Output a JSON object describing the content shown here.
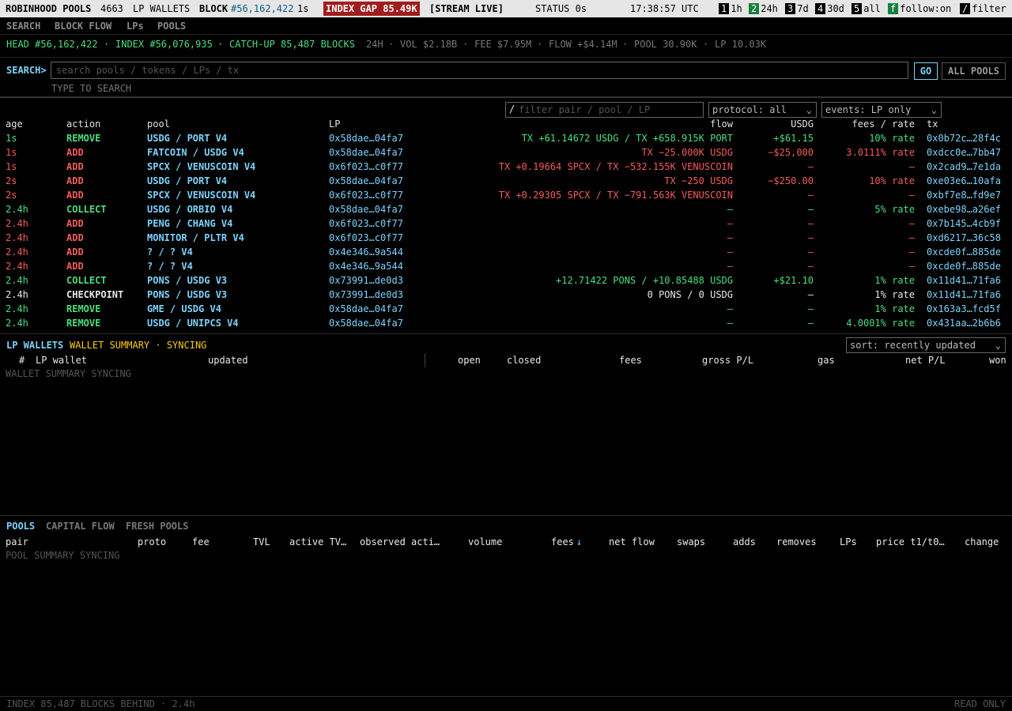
{
  "topbar": {
    "app_name": "ROBINHOOD POOLS",
    "wallet_count": "4663",
    "wallets_label": "LP WALLETS",
    "block_label": "BLOCK",
    "block_number": "#56,162,422",
    "block_age": "1s",
    "index_gap": "INDEX GAP 85.49K",
    "stream": "[STREAM LIVE]",
    "status": "STATUS 0s",
    "clock": "17:38:57 UTC",
    "ranges": [
      {
        "key": "1",
        "label": "1h"
      },
      {
        "key": "2",
        "label": "24h"
      },
      {
        "key": "3",
        "label": "7d"
      },
      {
        "key": "4",
        "label": "30d"
      },
      {
        "key": "5",
        "label": "all"
      }
    ],
    "follow_key": "f",
    "follow_label": "follow:",
    "follow_value": "on",
    "filter_key": "/",
    "filter_label": "filter",
    "active_range_color": "#15803d"
  },
  "nav": {
    "items": [
      "SEARCH",
      "BLOCK FLOW",
      "LPs",
      "POOLS"
    ]
  },
  "headline": {
    "head": "HEAD #56,162,422",
    "index": "INDEX #56,076,935",
    "catchup": "CATCH-UP 85,487 BLOCKS",
    "window": "24H",
    "vol": "VOL $2.18B",
    "fee": "FEE $7.95M",
    "flow": "FLOW +$4.14M",
    "pool": "POOL 30.90K",
    "lp": "LP 10.03K",
    "dot": "·"
  },
  "search": {
    "prompt": "SEARCH>",
    "placeholder": "search pools / tokens / LPs / tx",
    "go": "GO",
    "all_pools": "ALL POOLS",
    "hint": "TYPE TO SEARCH"
  },
  "events": {
    "filter_slash": "/",
    "filter_placeholder": "filter pair / pool / LP",
    "protocol": "protocol: all",
    "event_type": "events: LP only",
    "chevron": "⌄",
    "headers": {
      "age": "age",
      "action": "action",
      "pool": "pool",
      "lp": "LP",
      "flow": "flow",
      "usdg": "USDG",
      "fees": "fees / rate",
      "tx": "tx"
    },
    "rows": [
      {
        "age": "1s",
        "action": "REMOVE",
        "pool": "USDG / PORT V4",
        "lp": "0x58dae…04fa7",
        "flow": "TX +61.14672 USDG / TX +658.915K PORT",
        "usdg": "+$61.15",
        "fees": "10% rate",
        "tx": "0x0b72c…28f4c",
        "c_age": "green",
        "c_action": "green",
        "c_flow": "green",
        "c_usdg": "green",
        "c_fees": "green"
      },
      {
        "age": "1s",
        "action": "ADD",
        "pool": "FATCOIN / USDG V4",
        "lp": "0x58dae…04fa7",
        "flow": "TX −25.000K USDG",
        "usdg": "−$25,000",
        "fees": "3.0111% rate",
        "tx": "0xdcc0e…7bb47",
        "c_age": "red",
        "c_action": "red",
        "c_flow": "red",
        "c_usdg": "red",
        "c_fees": "red"
      },
      {
        "age": "1s",
        "action": "ADD",
        "pool": "SPCX / VENUSCOIN V4",
        "lp": "0x6f023…c0f77",
        "flow": "TX +0.19664 SPCX / TX −532.155K VENUSCOIN",
        "usdg": "—",
        "fees": "—",
        "tx": "0x2cad9…7e1da",
        "c_age": "red",
        "c_action": "red",
        "c_flow": "red",
        "c_usdg": "red",
        "c_fees": "red"
      },
      {
        "age": "2s",
        "action": "ADD",
        "pool": "USDG / PORT V4",
        "lp": "0x58dae…04fa7",
        "flow": "TX −250 USDG",
        "usdg": "−$250.00",
        "fees": "10% rate",
        "tx": "0xe03e6…10afa",
        "c_age": "red",
        "c_action": "red",
        "c_flow": "red",
        "c_usdg": "red",
        "c_fees": "red"
      },
      {
        "age": "2s",
        "action": "ADD",
        "pool": "SPCX / VENUSCOIN V4",
        "lp": "0x6f023…c0f77",
        "flow": "TX +0.29305 SPCX / TX −791.563K VENUSCOIN",
        "usdg": "—",
        "fees": "—",
        "tx": "0xbf7e8…fd9e7",
        "c_age": "red",
        "c_action": "red",
        "c_flow": "red",
        "c_usdg": "red",
        "c_fees": "red"
      },
      {
        "age": "2.4h",
        "action": "COLLECT",
        "pool": "USDG / ORBIO V4",
        "lp": "0x58dae…04fa7",
        "flow": "—",
        "usdg": "—",
        "fees": "5% rate",
        "tx": "0xebe98…a26ef",
        "c_age": "green",
        "c_action": "green",
        "c_flow": "green",
        "c_usdg": "green",
        "c_fees": "green"
      },
      {
        "age": "2.4h",
        "action": "ADD",
        "pool": "PENG / CHANG V4",
        "lp": "0x6f023…c0f77",
        "flow": "—",
        "usdg": "—",
        "fees": "—",
        "tx": "0x7b145…4cb9f",
        "c_age": "red",
        "c_action": "red",
        "c_flow": "red",
        "c_usdg": "red",
        "c_fees": "red"
      },
      {
        "age": "2.4h",
        "action": "ADD",
        "pool": "MONITOR / PLTR V4",
        "lp": "0x6f023…c0f77",
        "flow": "—",
        "usdg": "—",
        "fees": "—",
        "tx": "0xd6217…36c58",
        "c_age": "red",
        "c_action": "red",
        "c_flow": "red",
        "c_usdg": "red",
        "c_fees": "red"
      },
      {
        "age": "2.4h",
        "action": "ADD",
        "pool": "? / ? V4",
        "lp": "0x4e346…9a544",
        "flow": "—",
        "usdg": "—",
        "fees": "—",
        "tx": "0xcde0f…885de",
        "c_age": "red",
        "c_action": "red",
        "c_flow": "red",
        "c_usdg": "red",
        "c_fees": "red"
      },
      {
        "age": "2.4h",
        "action": "ADD",
        "pool": "? / ? V4",
        "lp": "0x4e346…9a544",
        "flow": "—",
        "usdg": "—",
        "fees": "—",
        "tx": "0xcde0f…885de",
        "c_age": "red",
        "c_action": "red",
        "c_flow": "red",
        "c_usdg": "red",
        "c_fees": "red"
      },
      {
        "age": "2.4h",
        "action": "COLLECT",
        "pool": "PONS / USDG V3",
        "lp": "0x73991…de0d3",
        "flow": "+12.71422 PONS / +10.85488 USDG",
        "usdg": "+$21.10",
        "fees": "1% rate",
        "tx": "0x11d41…71fa6",
        "c_age": "green",
        "c_action": "green",
        "c_flow": "green",
        "c_usdg": "green",
        "c_fees": "green"
      },
      {
        "age": "2.4h",
        "action": "CHECKPOINT",
        "pool": "PONS / USDG V3",
        "lp": "0x73991…de0d3",
        "flow": "0 PONS / 0 USDG",
        "usdg": "—",
        "fees": "1% rate",
        "tx": "0x11d41…71fa6",
        "c_age": "white",
        "c_action": "white",
        "c_flow": "white",
        "c_usdg": "white",
        "c_fees": "white"
      },
      {
        "age": "2.4h",
        "action": "REMOVE",
        "pool": "GME / USDG V4",
        "lp": "0x58dae…04fa7",
        "flow": "—",
        "usdg": "—",
        "fees": "1% rate",
        "tx": "0x163a3…fcd5f",
        "c_age": "green",
        "c_action": "green",
        "c_flow": "green",
        "c_usdg": "green",
        "c_fees": "green"
      },
      {
        "age": "2.4h",
        "action": "REMOVE",
        "pool": "USDG / UNIPCS V4",
        "lp": "0x58dae…04fa7",
        "flow": "—",
        "usdg": "—",
        "fees": "4.0001% rate",
        "tx": "0x431aa…2b6b6",
        "c_age": "green",
        "c_action": "green",
        "c_flow": "green",
        "c_usdg": "green",
        "c_fees": "green"
      }
    ]
  },
  "wallets": {
    "title": "LP WALLETS",
    "summary": "WALLET SUMMARY · SYNCING",
    "sort": "sort: recently updated",
    "headers": {
      "num": "#",
      "wallet": "LP wallet",
      "updated": "updated",
      "open": "open",
      "closed": "closed",
      "fees": "fees",
      "gross": "gross P/L",
      "gas": "gas",
      "net": "net P/L",
      "won": "won"
    },
    "empty": "WALLET SUMMARY SYNCING"
  },
  "pools": {
    "tabs": [
      "POOLS",
      "CAPITAL FLOW",
      "FRESH POOLS"
    ],
    "headers": {
      "pair": "pair",
      "proto": "proto",
      "fee": "fee",
      "tvl": "TVL",
      "active_tvl": "active TV…",
      "observed": "observed acti…",
      "volume": "volume",
      "fees": "fees",
      "fees_sort": "↓",
      "net_flow": "net flow",
      "swaps": "swaps",
      "adds": "adds",
      "removes": "removes",
      "lps": "LPs",
      "price": "price t1/t0…",
      "change": "change"
    },
    "empty": "POOL SUMMARY SYNCING"
  },
  "footer": {
    "left": "INDEX 85,487 BLOCKS BEHIND · 2.4h",
    "right": "READ ONLY"
  }
}
